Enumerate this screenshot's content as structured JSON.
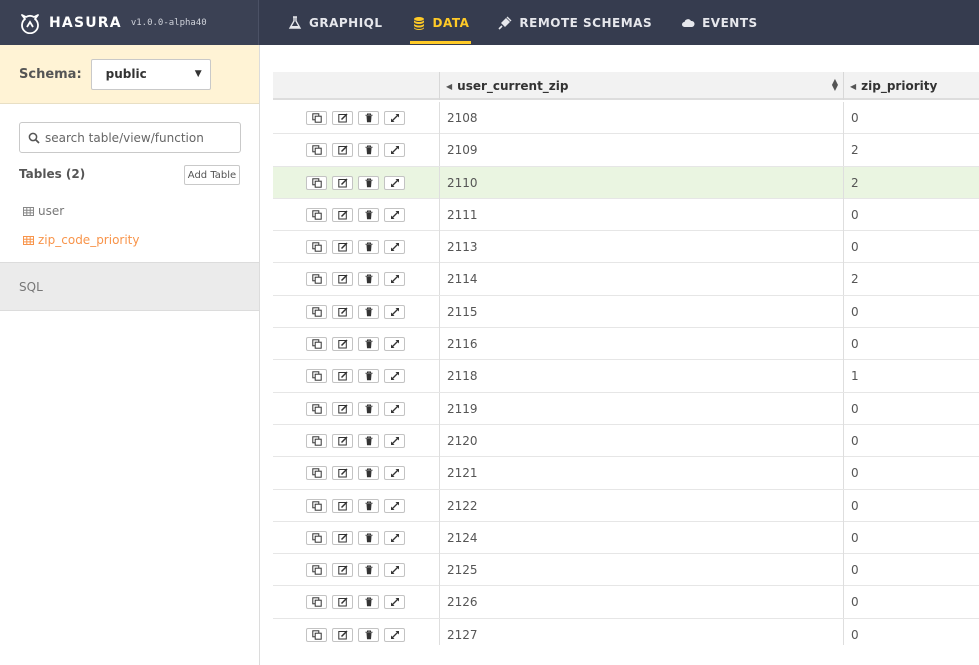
{
  "brand": {
    "name": "HASURA",
    "version": "v1.0.0-alpha40"
  },
  "nav": [
    {
      "label": "GRAPHIQL",
      "icon": "flask-icon",
      "active": false
    },
    {
      "label": "DATA",
      "icon": "database-icon",
      "active": true
    },
    {
      "label": "REMOTE SCHEMAS",
      "icon": "plug-icon",
      "active": false
    },
    {
      "label": "EVENTS",
      "icon": "cloud-icon",
      "active": false
    }
  ],
  "sidebar": {
    "schema_label": "Schema:",
    "schema_value": "public",
    "search_placeholder": "search table/view/function",
    "tables_heading": "Tables (2)",
    "add_table_label": "Add Table",
    "tables": [
      {
        "label": "user",
        "active": false
      },
      {
        "label": "zip_code_priority",
        "active": true
      }
    ],
    "sql_label": "SQL"
  },
  "grid": {
    "columns": [
      "user_current_zip",
      "zip_priority"
    ],
    "highlight_color": "#eaf5e1",
    "rows": [
      {
        "zip": "2108",
        "priority": "0"
      },
      {
        "zip": "2109",
        "priority": "2"
      },
      {
        "zip": "2110",
        "priority": "2"
      },
      {
        "zip": "2111",
        "priority": "0"
      },
      {
        "zip": "2113",
        "priority": "0"
      },
      {
        "zip": "2114",
        "priority": "2"
      },
      {
        "zip": "2115",
        "priority": "0"
      },
      {
        "zip": "2116",
        "priority": "0"
      },
      {
        "zip": "2118",
        "priority": "1"
      },
      {
        "zip": "2119",
        "priority": "0"
      },
      {
        "zip": "2120",
        "priority": "0"
      },
      {
        "zip": "2121",
        "priority": "0"
      },
      {
        "zip": "2122",
        "priority": "0"
      },
      {
        "zip": "2124",
        "priority": "0"
      },
      {
        "zip": "2125",
        "priority": "0"
      },
      {
        "zip": "2126",
        "priority": "0"
      },
      {
        "zip": "2127",
        "priority": "0"
      }
    ],
    "highlighted_row": "2110",
    "row_actions": [
      "clone-icon",
      "edit-icon",
      "delete-icon",
      "expand-icon"
    ]
  },
  "colors": {
    "topbar": "#363c4f",
    "accent": "#ffca27",
    "active_table": "#f8944a",
    "schema_bar": "#fff3d5"
  }
}
